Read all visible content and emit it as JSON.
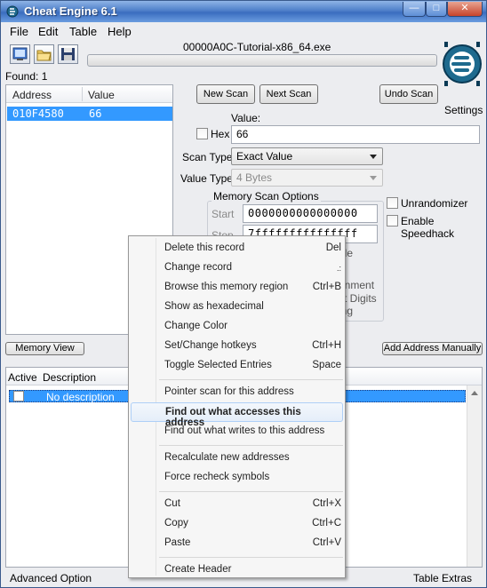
{
  "window": {
    "title": "Cheat Engine 6.1",
    "process_title": "00000A0C-Tutorial-x86_64.exe"
  },
  "menu": [
    "File",
    "Edit",
    "Table",
    "Help"
  ],
  "found_label": "Found: 1",
  "address_list": {
    "columns": [
      "Address",
      "Value"
    ],
    "rows": [
      {
        "address": "010F4580",
        "value": "66"
      }
    ]
  },
  "scan": {
    "new_scan": "New Scan",
    "next_scan": "Next Scan",
    "undo_scan": "Undo Scan",
    "settings": "Settings",
    "value_label": "Value:",
    "hex_label": "Hex",
    "value": "66",
    "scan_type_label": "Scan Type",
    "scan_type": "Exact Value",
    "value_type_label": "Value Type",
    "value_type": "4 Bytes",
    "memory_options_label": "Memory Scan Options",
    "start_label": "Start",
    "start_value": "0000000000000000",
    "stop_label": "Stop",
    "stop_value": "7fffffffffffffff",
    "partial_1": "ble",
    "partial_2": "gnment",
    "partial_3": "st Digits",
    "partial_4": "ing",
    "unrandomizer": "Unrandomizer",
    "speedhack": "Enable Speedhack"
  },
  "memory_view_button": "Memory View",
  "add_address_button": "Add Address Manually",
  "cheat_table": {
    "columns": [
      "Active",
      "Description"
    ],
    "rows": [
      {
        "description": "No description"
      }
    ]
  },
  "status": {
    "left": "Advanced Option",
    "right": "Table Extras"
  },
  "context_menu": [
    {
      "label": "Delete this record",
      "shortcut": "Del"
    },
    {
      "label": "Change record",
      "shortcut": ""
    },
    {
      "label": "Browse this memory region",
      "shortcut": "Ctrl+B"
    },
    {
      "label": "Show as hexadecimal",
      "shortcut": ""
    },
    {
      "label": "Change Color",
      "shortcut": ""
    },
    {
      "label": "Set/Change hotkeys",
      "shortcut": "Ctrl+H"
    },
    {
      "label": "Toggle Selected Entries",
      "shortcut": "Space"
    },
    {
      "label": "Pointer scan for this address",
      "shortcut": ""
    },
    {
      "label": "Find out what accesses this address",
      "shortcut": ""
    },
    {
      "label": "Find out what writes to this address",
      "shortcut": ""
    },
    {
      "label": "Recalculate new addresses",
      "shortcut": ""
    },
    {
      "label": "Force recheck symbols",
      "shortcut": ""
    },
    {
      "label": "Cut",
      "shortcut": "Ctrl+X"
    },
    {
      "label": "Copy",
      "shortcut": "Ctrl+C"
    },
    {
      "label": "Paste",
      "shortcut": "Ctrl+V"
    },
    {
      "label": "Create Header",
      "shortcut": ""
    }
  ],
  "context_menu_highlighted": "Find out what accesses this address",
  "colors": {
    "selection": "#3399ff",
    "title_bar": "#4f80c9",
    "logo": "#1e6a8e"
  },
  "icons": [
    "cheat-engine-logo",
    "process-list-icon",
    "open-file-icon",
    "save-icon",
    "minimize-icon",
    "maximize-icon",
    "close-icon"
  ]
}
